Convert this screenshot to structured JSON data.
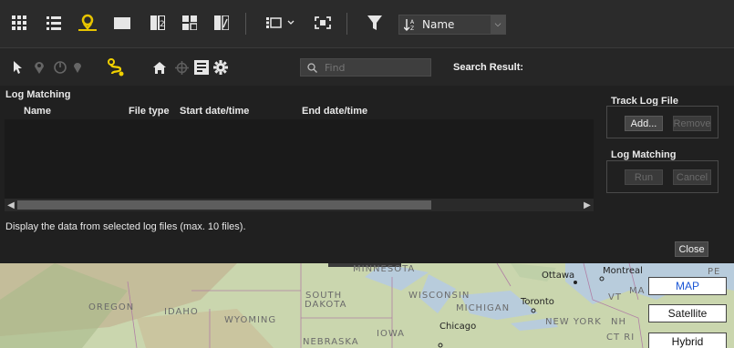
{
  "toolbar": {
    "icons": [
      "grid-view-icon",
      "list-view-icon",
      "map-view-icon",
      "single-view-icon",
      "compare-view-icon",
      "filmstrip-view-icon",
      "edit-view-icon",
      "layout-icon",
      "fullscreen-icon",
      "filter-icon"
    ],
    "sort_label": "Name",
    "accent": "#e7c400"
  },
  "toolbar2": {
    "find_placeholder": "Find",
    "search_result_label": "Search Result:"
  },
  "log_matching": {
    "title": "Log Matching",
    "columns": [
      "Name",
      "File type",
      "Start date/time",
      "End date/time"
    ],
    "rows": [],
    "info_text": "Display the data from selected log files (max. 10 files).",
    "close_label": "Close"
  },
  "track_log_file": {
    "title": "Track Log File",
    "add_label": "Add...",
    "remove_label": "Remove"
  },
  "log_matching_actions": {
    "title": "Log Matching",
    "run_label": "Run",
    "cancel_label": "Cancel"
  },
  "map": {
    "labels": [
      "MINNESOTA",
      "Ottawa",
      "Montreal",
      "SOUTH",
      "DAKOTA",
      "WISCONSIN",
      "Toronto",
      "OREGON",
      "IDAHO",
      "WYOMING",
      "MICHIGAN",
      "NEW YORK",
      "Chicago",
      "IOWA",
      "NEBRASKA",
      "VT",
      "MA",
      "NH",
      "CT RI",
      "PE"
    ],
    "buttons": [
      "MAP",
      "Satellite",
      "Hybrid"
    ]
  }
}
